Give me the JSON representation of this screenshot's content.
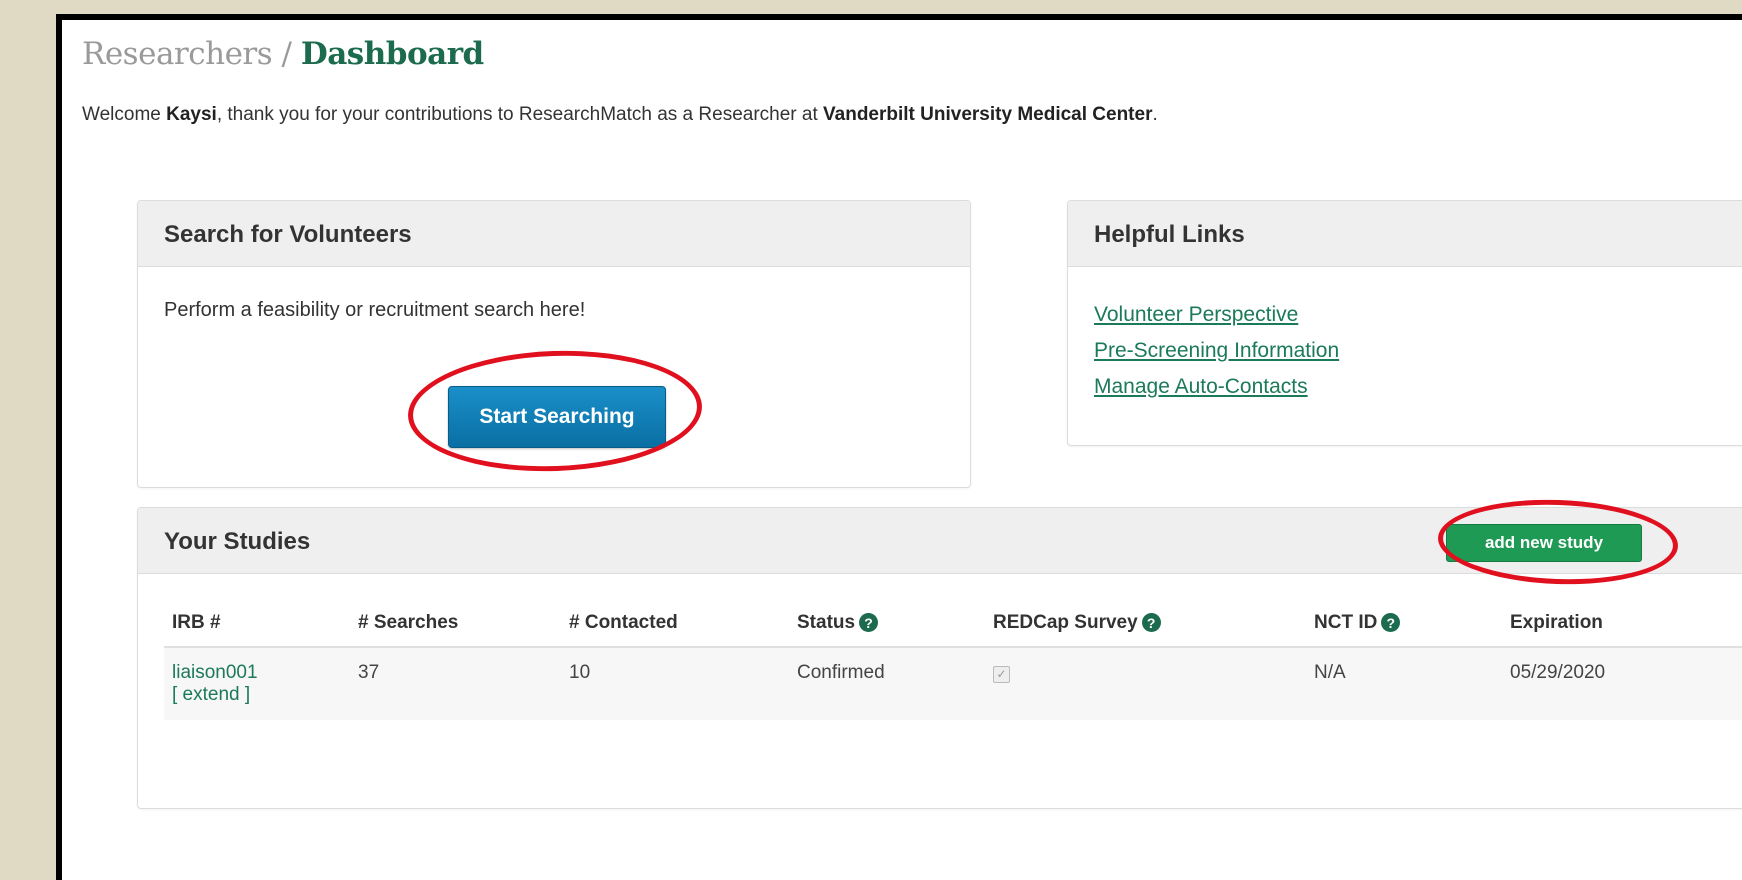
{
  "breadcrumb": {
    "parent": "Researchers",
    "separator": " / ",
    "current": "Dashboard"
  },
  "welcome": {
    "prefix": "Welcome ",
    "name": "Kaysi",
    "middle": ", thank you for your contributions to ResearchMatch as a Researcher at ",
    "institution": "Vanderbilt University Medical Center",
    "suffix": "."
  },
  "search_panel": {
    "title": "Search for Volunteers",
    "description": "Perform a feasibility or recruitment search here!",
    "button_label": "Start Searching"
  },
  "links_panel": {
    "title": "Helpful Links",
    "links": [
      "Volunteer Perspective",
      "Pre-Screening Information",
      "Manage Auto-Contacts"
    ]
  },
  "studies_panel": {
    "title": "Your Studies",
    "add_button_label": "add new study",
    "columns": [
      "IRB #",
      "# Searches",
      "# Contacted",
      "Status",
      "REDCap Survey",
      "NCT ID",
      "Expiration"
    ],
    "rows": [
      {
        "irb": "liaison001",
        "extend": "[ extend ]",
        "searches": "37",
        "contacted": "10",
        "status": "Confirmed",
        "redcap_checked": true,
        "nct_id": "N/A",
        "expiration": "05/29/2020"
      }
    ]
  },
  "icons": {
    "help": "question-circle-icon",
    "check": "checkbox-checked-icon"
  },
  "colors": {
    "brand_green": "#1c6b4e",
    "primary_blue": "#0a6fa3",
    "add_green": "#1e9a55",
    "annotation_red": "#e0101e"
  }
}
